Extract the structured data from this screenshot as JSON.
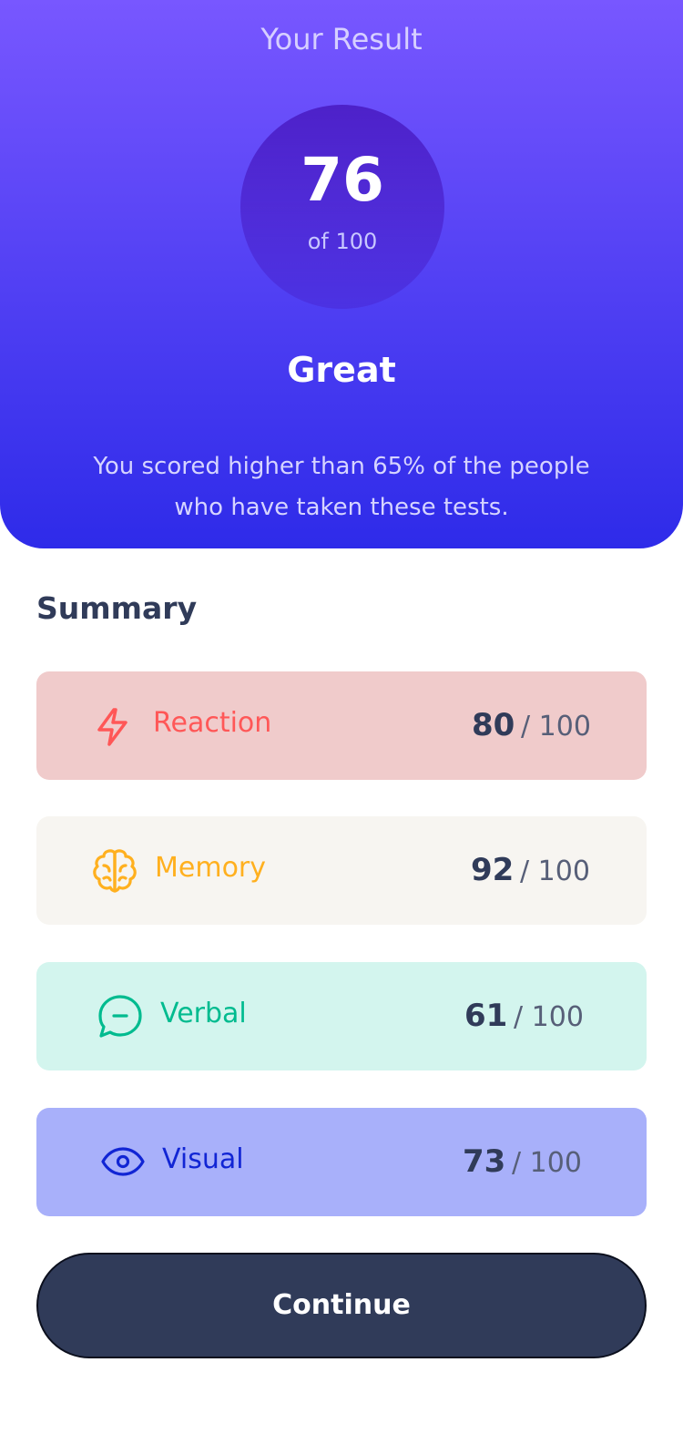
{
  "result": {
    "title": "Your Result",
    "score": "76",
    "of_label": "of 100",
    "grade": "Great",
    "description": "You scored higher than 65% of the people who have taken these tests."
  },
  "summary": {
    "title": "Summary",
    "items": [
      {
        "label": "Reaction",
        "score": "80",
        "max": "/ 100",
        "icon": "lightning-icon",
        "color": "#ff5757",
        "bg": "#f0cbcb"
      },
      {
        "label": "Memory",
        "score": "92",
        "max": "/ 100",
        "icon": "brain-icon",
        "color": "#ffb01f",
        "bg": "#f7f5f1"
      },
      {
        "label": "Verbal",
        "score": "61",
        "max": "/ 100",
        "icon": "chat-bubble-icon",
        "color": "#00bb8f",
        "bg": "#d3f5ee"
      },
      {
        "label": "Visual",
        "score": "73",
        "max": "/ 100",
        "icon": "eye-icon",
        "color": "#1125d4",
        "bg": "#a8b0fa"
      }
    ]
  },
  "continue_label": "Continue",
  "colors": {
    "gradient_top": "#7857ff",
    "gradient_bottom": "#2e2be9",
    "dark_navy": "#303b59"
  }
}
